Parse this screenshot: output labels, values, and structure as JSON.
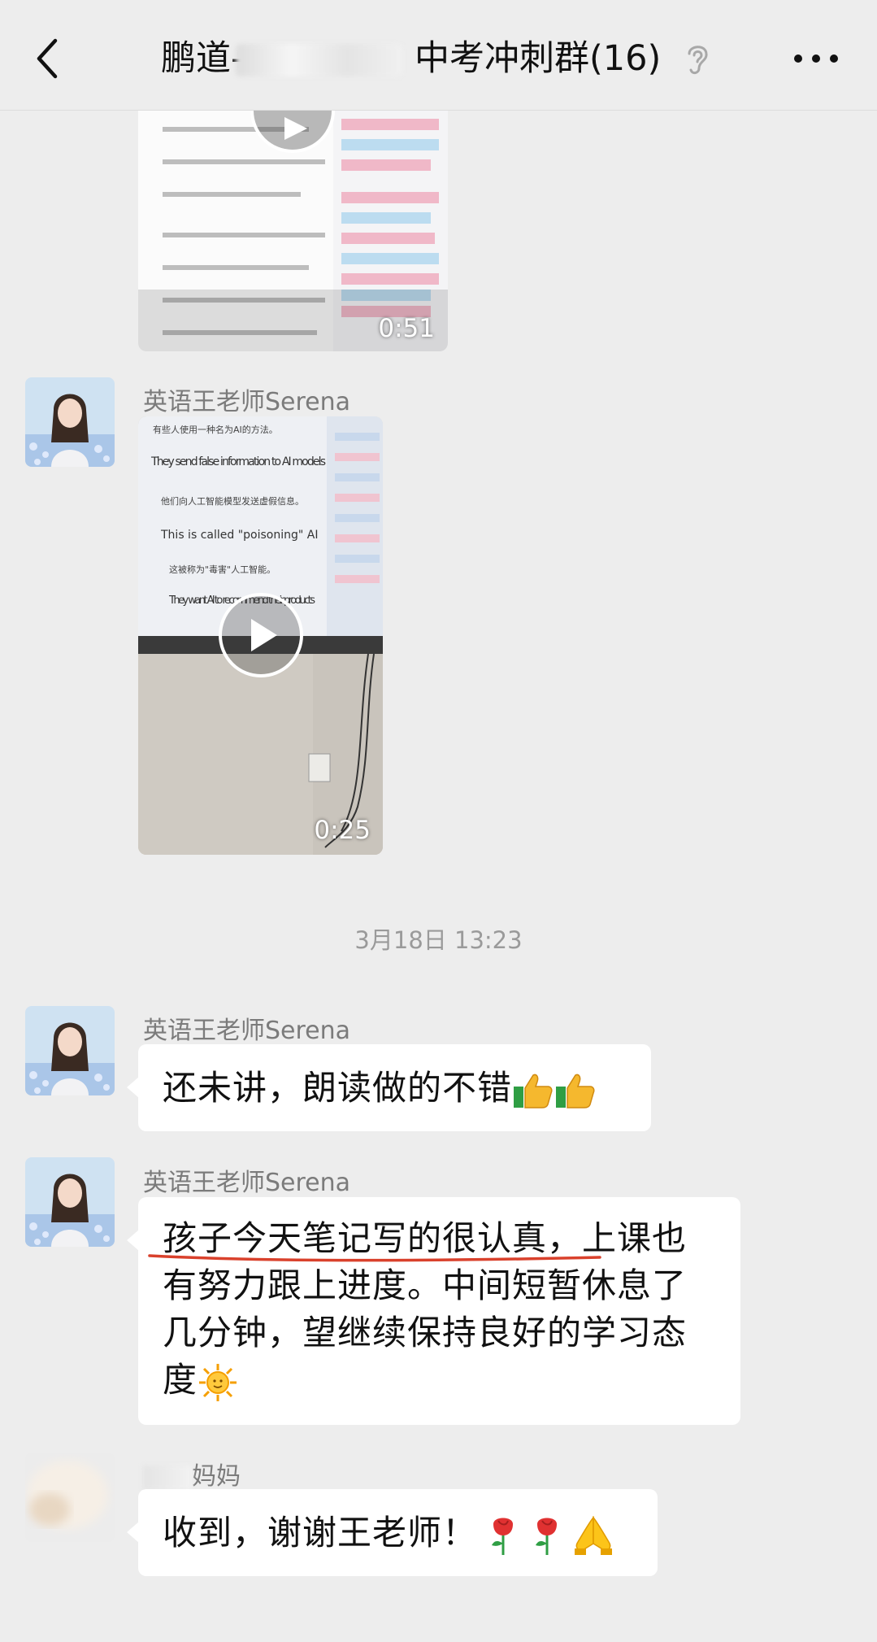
{
  "header": {
    "title_left": "鹏道-",
    "title_right": "中考冲刺群(16)"
  },
  "videos": [
    {
      "duration": "0:51"
    },
    {
      "duration": "0:25"
    }
  ],
  "slide_text": {
    "top": "有些人使用一种名为AI的方法。",
    "line1": "They send false information to AI models",
    "mid": "他们向人工智能模型发送虚假信息。",
    "line2": "This is called \"poisoning\" AI",
    "mid2": "这被称为\"毒害\"人工智能。",
    "line3": "They want AI to recommend their products"
  },
  "timestamp": "3月18日 13:23",
  "messages": [
    {
      "sender": "英语王老师Serena",
      "text": "还未讲，朗读做的不错"
    },
    {
      "sender": "英语王老师Serena",
      "text_lines": [
        "孩子今天笔记写的很认真，上课也",
        "有努力跟上进度。中间短暂休息了",
        "几分钟，望继续保持良好的学习态",
        "度"
      ]
    },
    {
      "sender": "妈妈",
      "text": "收到，谢谢王老师！"
    }
  ],
  "video_sender": "英语王老师Serena",
  "colors": {
    "background": "#ededed",
    "bubble": "#ffffff",
    "underline": "#d9412c"
  }
}
